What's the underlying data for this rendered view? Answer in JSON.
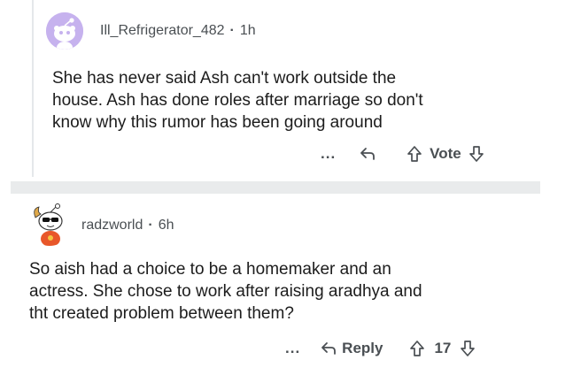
{
  "comments": [
    {
      "username": "Ill_Refrigerator_482",
      "separator": "·",
      "time": "1h",
      "body": [
        "She has never said Ash can't work outside the",
        "house. Ash has done roles after marriage so don't",
        "know why this rumor has been going around"
      ],
      "more_label": "...",
      "vote_label": "Vote"
    },
    {
      "username": "radzworld",
      "separator": "·",
      "time": "6h",
      "body": [
        "So aish had a choice to be a homemaker and an",
        "actress. She chose to work after raising aradhya and",
        "tht created problem between them?"
      ],
      "more_label": "...",
      "reply_label": "Reply",
      "score": "17"
    }
  ],
  "colors": {
    "avatar1_bg": "#c6b2ee",
    "text": "#1c1c1c",
    "meta": "#4a4f53",
    "divider": "#e9ebec"
  }
}
